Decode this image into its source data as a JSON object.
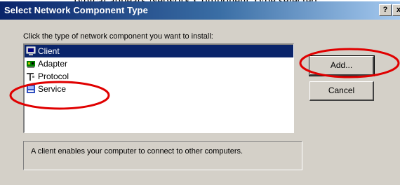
{
  "page_fragment": {
    "text": "typical appears Network Component Type selected..."
  },
  "window": {
    "title": "Select Network Component Type",
    "help_label": "?",
    "close_label": "x"
  },
  "instruction": "Click the type of network component you want to install:",
  "components": [
    {
      "label": "Client",
      "icon": "client-icon",
      "selected": true
    },
    {
      "label": "Adapter",
      "icon": "adapter-icon",
      "selected": false
    },
    {
      "label": "Protocol",
      "icon": "protocol-icon",
      "selected": false
    },
    {
      "label": "Service",
      "icon": "service-icon",
      "selected": false
    }
  ],
  "buttons": {
    "add_label": "Add...",
    "cancel_label": "Cancel"
  },
  "description": "A client enables your computer to connect to other computers.",
  "colors": {
    "selection": "#0a246a",
    "annotation": "#e00000",
    "dialog_face": "#d4d0c8"
  }
}
